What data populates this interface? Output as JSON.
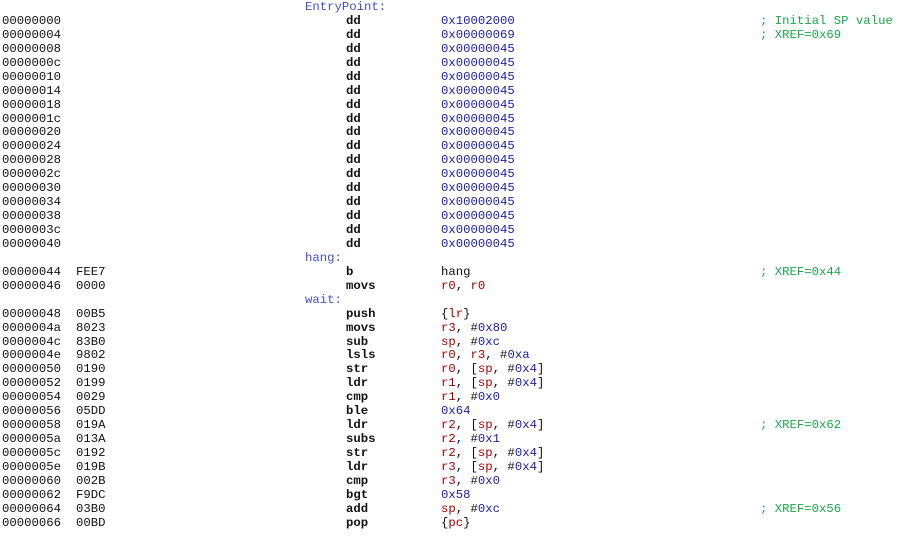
{
  "colors": {
    "label": "#4050c8",
    "hex": "#1c1ca8",
    "register": "#a80000",
    "comment": "#1aa84a",
    "text": "#111111"
  },
  "lines": [
    {
      "type": "label",
      "label": "EntryPoint:"
    },
    {
      "type": "insn",
      "addr": "00000000",
      "bytes": "",
      "mnem": "dd",
      "ops": [
        {
          "k": "hex",
          "t": "0x10002000"
        }
      ],
      "comment": "; Initial SP value"
    },
    {
      "type": "insn",
      "addr": "00000004",
      "bytes": "",
      "mnem": "dd",
      "ops": [
        {
          "k": "hex",
          "t": "0x00000069"
        }
      ],
      "comment": "; XREF=0x69"
    },
    {
      "type": "insn",
      "addr": "00000008",
      "bytes": "",
      "mnem": "dd",
      "ops": [
        {
          "k": "hex",
          "t": "0x00000045"
        }
      ],
      "comment": ""
    },
    {
      "type": "insn",
      "addr": "0000000c",
      "bytes": "",
      "mnem": "dd",
      "ops": [
        {
          "k": "hex",
          "t": "0x00000045"
        }
      ],
      "comment": ""
    },
    {
      "type": "insn",
      "addr": "00000010",
      "bytes": "",
      "mnem": "dd",
      "ops": [
        {
          "k": "hex",
          "t": "0x00000045"
        }
      ],
      "comment": ""
    },
    {
      "type": "insn",
      "addr": "00000014",
      "bytes": "",
      "mnem": "dd",
      "ops": [
        {
          "k": "hex",
          "t": "0x00000045"
        }
      ],
      "comment": ""
    },
    {
      "type": "insn",
      "addr": "00000018",
      "bytes": "",
      "mnem": "dd",
      "ops": [
        {
          "k": "hex",
          "t": "0x00000045"
        }
      ],
      "comment": ""
    },
    {
      "type": "insn",
      "addr": "0000001c",
      "bytes": "",
      "mnem": "dd",
      "ops": [
        {
          "k": "hex",
          "t": "0x00000045"
        }
      ],
      "comment": ""
    },
    {
      "type": "insn",
      "addr": "00000020",
      "bytes": "",
      "mnem": "dd",
      "ops": [
        {
          "k": "hex",
          "t": "0x00000045"
        }
      ],
      "comment": ""
    },
    {
      "type": "insn",
      "addr": "00000024",
      "bytes": "",
      "mnem": "dd",
      "ops": [
        {
          "k": "hex",
          "t": "0x00000045"
        }
      ],
      "comment": ""
    },
    {
      "type": "insn",
      "addr": "00000028",
      "bytes": "",
      "mnem": "dd",
      "ops": [
        {
          "k": "hex",
          "t": "0x00000045"
        }
      ],
      "comment": ""
    },
    {
      "type": "insn",
      "addr": "0000002c",
      "bytes": "",
      "mnem": "dd",
      "ops": [
        {
          "k": "hex",
          "t": "0x00000045"
        }
      ],
      "comment": ""
    },
    {
      "type": "insn",
      "addr": "00000030",
      "bytes": "",
      "mnem": "dd",
      "ops": [
        {
          "k": "hex",
          "t": "0x00000045"
        }
      ],
      "comment": ""
    },
    {
      "type": "insn",
      "addr": "00000034",
      "bytes": "",
      "mnem": "dd",
      "ops": [
        {
          "k": "hex",
          "t": "0x00000045"
        }
      ],
      "comment": ""
    },
    {
      "type": "insn",
      "addr": "00000038",
      "bytes": "",
      "mnem": "dd",
      "ops": [
        {
          "k": "hex",
          "t": "0x00000045"
        }
      ],
      "comment": ""
    },
    {
      "type": "insn",
      "addr": "0000003c",
      "bytes": "",
      "mnem": "dd",
      "ops": [
        {
          "k": "hex",
          "t": "0x00000045"
        }
      ],
      "comment": ""
    },
    {
      "type": "insn",
      "addr": "00000040",
      "bytes": "",
      "mnem": "dd",
      "ops": [
        {
          "k": "hex",
          "t": "0x00000045"
        }
      ],
      "comment": ""
    },
    {
      "type": "label",
      "label": "hang:"
    },
    {
      "type": "insn",
      "addr": "00000044",
      "bytes": "FEE7",
      "mnem": "b",
      "ops": [
        {
          "k": "ref",
          "t": "hang"
        }
      ],
      "comment": "; XREF=0x44"
    },
    {
      "type": "insn",
      "addr": "00000046",
      "bytes": "0000",
      "mnem": "movs",
      "ops": [
        {
          "k": "reg",
          "t": "r0"
        },
        {
          "k": "sym",
          "t": ", "
        },
        {
          "k": "reg",
          "t": "r0"
        }
      ],
      "comment": ""
    },
    {
      "type": "label",
      "label": "wait:"
    },
    {
      "type": "insn",
      "addr": "00000048",
      "bytes": "00B5",
      "mnem": "push",
      "ops": [
        {
          "k": "sym",
          "t": "{"
        },
        {
          "k": "reg",
          "t": "lr"
        },
        {
          "k": "sym",
          "t": "}"
        }
      ],
      "comment": ""
    },
    {
      "type": "insn",
      "addr": "0000004a",
      "bytes": "8023",
      "mnem": "movs",
      "ops": [
        {
          "k": "reg",
          "t": "r3"
        },
        {
          "k": "sym",
          "t": ", #"
        },
        {
          "k": "hex",
          "t": "0x80"
        }
      ],
      "comment": ""
    },
    {
      "type": "insn",
      "addr": "0000004c",
      "bytes": "83B0",
      "mnem": "sub",
      "ops": [
        {
          "k": "reg",
          "t": "sp"
        },
        {
          "k": "sym",
          "t": ", #"
        },
        {
          "k": "hex",
          "t": "0xc"
        }
      ],
      "comment": ""
    },
    {
      "type": "insn",
      "addr": "0000004e",
      "bytes": "9802",
      "mnem": "lsls",
      "ops": [
        {
          "k": "reg",
          "t": "r0"
        },
        {
          "k": "sym",
          "t": ", "
        },
        {
          "k": "reg",
          "t": "r3"
        },
        {
          "k": "sym",
          "t": ", #"
        },
        {
          "k": "hex",
          "t": "0xa"
        }
      ],
      "comment": ""
    },
    {
      "type": "insn",
      "addr": "00000050",
      "bytes": "0190",
      "mnem": "str",
      "ops": [
        {
          "k": "reg",
          "t": "r0"
        },
        {
          "k": "sym",
          "t": ", ["
        },
        {
          "k": "reg",
          "t": "sp"
        },
        {
          "k": "sym",
          "t": ", #"
        },
        {
          "k": "hex",
          "t": "0x4"
        },
        {
          "k": "sym",
          "t": "]"
        }
      ],
      "comment": ""
    },
    {
      "type": "insn",
      "addr": "00000052",
      "bytes": "0199",
      "mnem": "ldr",
      "ops": [
        {
          "k": "reg",
          "t": "r1"
        },
        {
          "k": "sym",
          "t": ", ["
        },
        {
          "k": "reg",
          "t": "sp"
        },
        {
          "k": "sym",
          "t": ", #"
        },
        {
          "k": "hex",
          "t": "0x4"
        },
        {
          "k": "sym",
          "t": "]"
        }
      ],
      "comment": ""
    },
    {
      "type": "insn",
      "addr": "00000054",
      "bytes": "0029",
      "mnem": "cmp",
      "ops": [
        {
          "k": "reg",
          "t": "r1"
        },
        {
          "k": "sym",
          "t": ", #"
        },
        {
          "k": "hex",
          "t": "0x0"
        }
      ],
      "comment": ""
    },
    {
      "type": "insn",
      "addr": "00000056",
      "bytes": "05DD",
      "mnem": "ble",
      "ops": [
        {
          "k": "hex",
          "t": "0x64"
        }
      ],
      "comment": ""
    },
    {
      "type": "insn",
      "addr": "00000058",
      "bytes": "019A",
      "mnem": "ldr",
      "ops": [
        {
          "k": "reg",
          "t": "r2"
        },
        {
          "k": "sym",
          "t": ", ["
        },
        {
          "k": "reg",
          "t": "sp"
        },
        {
          "k": "sym",
          "t": ", #"
        },
        {
          "k": "hex",
          "t": "0x4"
        },
        {
          "k": "sym",
          "t": "]"
        }
      ],
      "comment": "; XREF=0x62"
    },
    {
      "type": "insn",
      "addr": "0000005a",
      "bytes": "013A",
      "mnem": "subs",
      "ops": [
        {
          "k": "reg",
          "t": "r2"
        },
        {
          "k": "sym",
          "t": ", #"
        },
        {
          "k": "hex",
          "t": "0x1"
        }
      ],
      "comment": ""
    },
    {
      "type": "insn",
      "addr": "0000005c",
      "bytes": "0192",
      "mnem": "str",
      "ops": [
        {
          "k": "reg",
          "t": "r2"
        },
        {
          "k": "sym",
          "t": ", ["
        },
        {
          "k": "reg",
          "t": "sp"
        },
        {
          "k": "sym",
          "t": ", #"
        },
        {
          "k": "hex",
          "t": "0x4"
        },
        {
          "k": "sym",
          "t": "]"
        }
      ],
      "comment": ""
    },
    {
      "type": "insn",
      "addr": "0000005e",
      "bytes": "019B",
      "mnem": "ldr",
      "ops": [
        {
          "k": "reg",
          "t": "r3"
        },
        {
          "k": "sym",
          "t": ", ["
        },
        {
          "k": "reg",
          "t": "sp"
        },
        {
          "k": "sym",
          "t": ", #"
        },
        {
          "k": "hex",
          "t": "0x4"
        },
        {
          "k": "sym",
          "t": "]"
        }
      ],
      "comment": ""
    },
    {
      "type": "insn",
      "addr": "00000060",
      "bytes": "002B",
      "mnem": "cmp",
      "ops": [
        {
          "k": "reg",
          "t": "r3"
        },
        {
          "k": "sym",
          "t": ", #"
        },
        {
          "k": "hex",
          "t": "0x0"
        }
      ],
      "comment": ""
    },
    {
      "type": "insn",
      "addr": "00000062",
      "bytes": "F9DC",
      "mnem": "bgt",
      "ops": [
        {
          "k": "hex",
          "t": "0x58"
        }
      ],
      "comment": ""
    },
    {
      "type": "insn",
      "addr": "00000064",
      "bytes": "03B0",
      "mnem": "add",
      "ops": [
        {
          "k": "reg",
          "t": "sp"
        },
        {
          "k": "sym",
          "t": ", #"
        },
        {
          "k": "hex",
          "t": "0xc"
        }
      ],
      "comment": "; XREF=0x56"
    },
    {
      "type": "insn",
      "addr": "00000066",
      "bytes": "00BD",
      "mnem": "pop",
      "ops": [
        {
          "k": "sym",
          "t": "{"
        },
        {
          "k": "reg",
          "t": "pc"
        },
        {
          "k": "sym",
          "t": "}"
        }
      ],
      "comment": ""
    }
  ]
}
